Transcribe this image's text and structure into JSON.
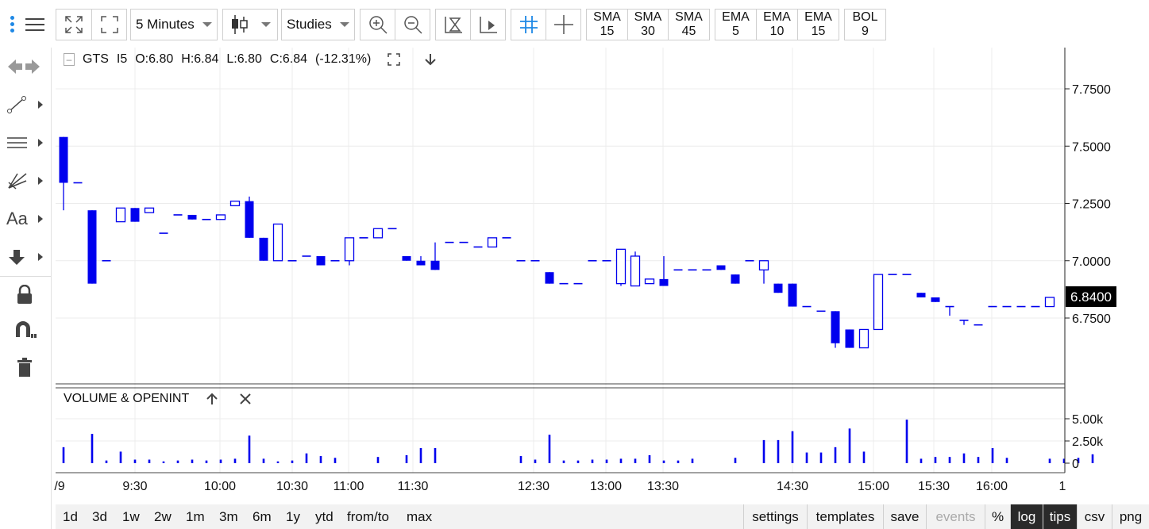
{
  "toolbar": {
    "interval": "5 Minutes",
    "studies_label": "Studies",
    "studies": [
      {
        "name": "SMA",
        "period": "15"
      },
      {
        "name": "SMA",
        "period": "30"
      },
      {
        "name": "SMA",
        "period": "45"
      },
      {
        "name": "EMA",
        "period": "5"
      },
      {
        "name": "EMA",
        "period": "10"
      },
      {
        "name": "EMA",
        "period": "15"
      },
      {
        "name": "BOL",
        "period": "9"
      }
    ]
  },
  "legend": {
    "symbol": "GTS",
    "interval_code": "I5",
    "open": "O:6.80",
    "high": "H:6.84",
    "low": "L:6.80",
    "close": "C:6.84",
    "change": "(-12.31%)"
  },
  "volume_panel": {
    "title": "VOLUME & OPENINT"
  },
  "price_axis": {
    "ticks": [
      "7.7500",
      "7.5000",
      "7.2500",
      "7.0000",
      "6.7500"
    ],
    "last_price": "6.8400"
  },
  "volume_axis": {
    "ticks": [
      "5.00k",
      "2.50k",
      "0"
    ]
  },
  "time_axis": [
    "/9",
    "9:30",
    "10:00",
    "10:30",
    "11:00",
    "11:30",
    "12:30",
    "13:00",
    "13:30",
    "14:30",
    "15:00",
    "15:30",
    "16:00",
    "1"
  ],
  "bottom": {
    "ranges": [
      "1d",
      "3d",
      "1w",
      "2w",
      "1m",
      "3m",
      "6m",
      "1y",
      "ytd",
      "from/to",
      "max"
    ],
    "actions": [
      "settings",
      "templates",
      "save",
      "events",
      "%",
      "log",
      "tips",
      "csv",
      "png"
    ]
  },
  "colors": {
    "up": "#0000ee",
    "down": "#0000ee",
    "volume": "#0000ee",
    "last_price_bg": "#000000"
  },
  "chart_data": {
    "type": "candlestick",
    "symbol": "GTS",
    "price_range": [
      6.5,
      7.9
    ],
    "candles": [
      {
        "o": 7.54,
        "h": 7.54,
        "l": 7.22,
        "c": 7.34
      },
      {
        "o": 7.34,
        "h": 7.34,
        "l": 7.34,
        "c": 7.34
      },
      {
        "o": 7.22,
        "h": 7.22,
        "l": 6.9,
        "c": 6.9
      },
      {
        "o": 7.0,
        "h": 7.0,
        "l": 7.0,
        "c": 7.0
      },
      {
        "o": 7.17,
        "h": 7.23,
        "l": 7.17,
        "c": 7.23
      },
      {
        "o": 7.23,
        "h": 7.23,
        "l": 7.17,
        "c": 7.17
      },
      {
        "o": 7.21,
        "h": 7.23,
        "l": 7.21,
        "c": 7.23
      },
      {
        "o": 7.12,
        "h": 7.12,
        "l": 7.12,
        "c": 7.12
      },
      {
        "o": 7.2,
        "h": 7.2,
        "l": 7.2,
        "c": 7.2
      },
      {
        "o": 7.2,
        "h": 7.2,
        "l": 7.18,
        "c": 7.18
      },
      {
        "o": 7.18,
        "h": 7.18,
        "l": 7.18,
        "c": 7.18
      },
      {
        "o": 7.18,
        "h": 7.2,
        "l": 7.18,
        "c": 7.2
      },
      {
        "o": 7.24,
        "h": 7.26,
        "l": 7.24,
        "c": 7.26
      },
      {
        "o": 7.26,
        "h": 7.28,
        "l": 7.1,
        "c": 7.1
      },
      {
        "o": 7.1,
        "h": 7.1,
        "l": 7.0,
        "c": 7.0
      },
      {
        "o": 7.0,
        "h": 7.16,
        "l": 7.0,
        "c": 7.16
      },
      {
        "o": 7.0,
        "h": 7.0,
        "l": 7.0,
        "c": 7.0
      },
      {
        "o": 7.02,
        "h": 7.02,
        "l": 7.02,
        "c": 7.02
      },
      {
        "o": 7.02,
        "h": 7.02,
        "l": 6.98,
        "c": 6.98
      },
      {
        "o": 7.0,
        "h": 7.0,
        "l": 7.0,
        "c": 7.0
      },
      {
        "o": 7.0,
        "h": 7.1,
        "l": 6.98,
        "c": 7.1
      },
      {
        "o": 7.1,
        "h": 7.1,
        "l": 7.1,
        "c": 7.1
      },
      {
        "o": 7.1,
        "h": 7.14,
        "l": 7.1,
        "c": 7.14
      },
      {
        "o": 7.14,
        "h": 7.14,
        "l": 7.14,
        "c": 7.14
      },
      {
        "o": 7.02,
        "h": 7.02,
        "l": 7.0,
        "c": 7.0
      },
      {
        "o": 7.0,
        "h": 7.02,
        "l": 6.98,
        "c": 6.98
      },
      {
        "o": 7.0,
        "h": 7.08,
        "l": 6.96,
        "c": 6.96
      },
      {
        "o": 7.08,
        "h": 7.08,
        "l": 7.08,
        "c": 7.08
      },
      {
        "o": 7.08,
        "h": 7.08,
        "l": 7.08,
        "c": 7.08
      },
      {
        "o": 7.06,
        "h": 7.06,
        "l": 7.06,
        "c": 7.06
      },
      {
        "o": 7.06,
        "h": 7.1,
        "l": 7.06,
        "c": 7.1
      },
      {
        "o": 7.1,
        "h": 7.1,
        "l": 7.1,
        "c": 7.1
      },
      {
        "o": 7.0,
        "h": 7.0,
        "l": 7.0,
        "c": 7.0
      },
      {
        "o": 7.0,
        "h": 7.0,
        "l": 7.0,
        "c": 7.0
      },
      {
        "o": 6.95,
        "h": 6.95,
        "l": 6.9,
        "c": 6.9
      },
      {
        "o": 6.9,
        "h": 6.9,
        "l": 6.9,
        "c": 6.9
      },
      {
        "o": 6.9,
        "h": 6.9,
        "l": 6.9,
        "c": 6.9
      },
      {
        "o": 7.0,
        "h": 7.0,
        "l": 7.0,
        "c": 7.0
      },
      {
        "o": 7.0,
        "h": 7.0,
        "l": 7.0,
        "c": 7.0
      },
      {
        "o": 6.9,
        "h": 7.05,
        "l": 6.89,
        "c": 7.05
      },
      {
        "o": 6.89,
        "h": 7.04,
        "l": 6.89,
        "c": 7.02
      },
      {
        "o": 6.9,
        "h": 6.92,
        "l": 6.9,
        "c": 6.92
      },
      {
        "o": 6.92,
        "h": 7.02,
        "l": 6.89,
        "c": 6.89
      },
      {
        "o": 6.96,
        "h": 6.96,
        "l": 6.96,
        "c": 6.96
      },
      {
        "o": 6.96,
        "h": 6.96,
        "l": 6.96,
        "c": 6.96
      },
      {
        "o": 6.96,
        "h": 6.96,
        "l": 6.96,
        "c": 6.96
      },
      {
        "o": 6.98,
        "h": 6.98,
        "l": 6.96,
        "c": 6.96
      },
      {
        "o": 6.94,
        "h": 6.94,
        "l": 6.9,
        "c": 6.9
      },
      {
        "o": 7.0,
        "h": 7.0,
        "l": 7.0,
        "c": 7.0
      },
      {
        "o": 6.96,
        "h": 7.0,
        "l": 6.9,
        "c": 7.0
      },
      {
        "o": 6.9,
        "h": 6.9,
        "l": 6.86,
        "c": 6.86
      },
      {
        "o": 6.9,
        "h": 6.9,
        "l": 6.8,
        "c": 6.8
      },
      {
        "o": 6.8,
        "h": 6.8,
        "l": 6.8,
        "c": 6.8
      },
      {
        "o": 6.78,
        "h": 6.78,
        "l": 6.78,
        "c": 6.78
      },
      {
        "o": 6.78,
        "h": 6.78,
        "l": 6.62,
        "c": 6.64
      },
      {
        "o": 6.7,
        "h": 6.7,
        "l": 6.62,
        "c": 6.62
      },
      {
        "o": 6.62,
        "h": 6.7,
        "l": 6.62,
        "c": 6.7
      },
      {
        "o": 6.7,
        "h": 6.94,
        "l": 6.7,
        "c": 6.94
      },
      {
        "o": 6.94,
        "h": 6.94,
        "l": 6.94,
        "c": 6.94
      },
      {
        "o": 6.94,
        "h": 6.94,
        "l": 6.94,
        "c": 6.94
      },
      {
        "o": 6.86,
        "h": 6.86,
        "l": 6.84,
        "c": 6.84
      },
      {
        "o": 6.84,
        "h": 6.84,
        "l": 6.82,
        "c": 6.82
      },
      {
        "o": 6.8,
        "h": 6.8,
        "l": 6.76,
        "c": 6.8
      },
      {
        "o": 6.74,
        "h": 6.74,
        "l": 6.72,
        "c": 6.74
      },
      {
        "o": 6.72,
        "h": 6.72,
        "l": 6.72,
        "c": 6.72
      },
      {
        "o": 6.8,
        "h": 6.8,
        "l": 6.8,
        "c": 6.8
      },
      {
        "o": 6.8,
        "h": 6.8,
        "l": 6.8,
        "c": 6.8
      },
      {
        "o": 6.8,
        "h": 6.8,
        "l": 6.8,
        "c": 6.8
      },
      {
        "o": 6.8,
        "h": 6.8,
        "l": 6.8,
        "c": 6.8
      },
      {
        "o": 6.8,
        "h": 6.84,
        "l": 6.8,
        "c": 6.84
      }
    ],
    "volume_range": [
      0,
      6000
    ],
    "volumes": [
      1800,
      0,
      3300,
      300,
      1300,
      400,
      400,
      200,
      300,
      400,
      300,
      400,
      500,
      3100,
      500,
      200,
      300,
      1100,
      800,
      600,
      0,
      0,
      700,
      0,
      900,
      1700,
      1700,
      0,
      0,
      0,
      0,
      0,
      800,
      400,
      3200,
      300,
      300,
      400,
      400,
      500,
      500,
      900,
      300,
      300,
      500,
      0,
      0,
      600,
      0,
      2600,
      2600,
      3600,
      1200,
      1200,
      1800,
      3900,
      1300,
      0,
      0,
      4900,
      500,
      700,
      700,
      1100,
      700,
      1700,
      600,
      0,
      0,
      500,
      500,
      600,
      1000
    ],
    "xlabel": "",
    "ylabel": ""
  }
}
